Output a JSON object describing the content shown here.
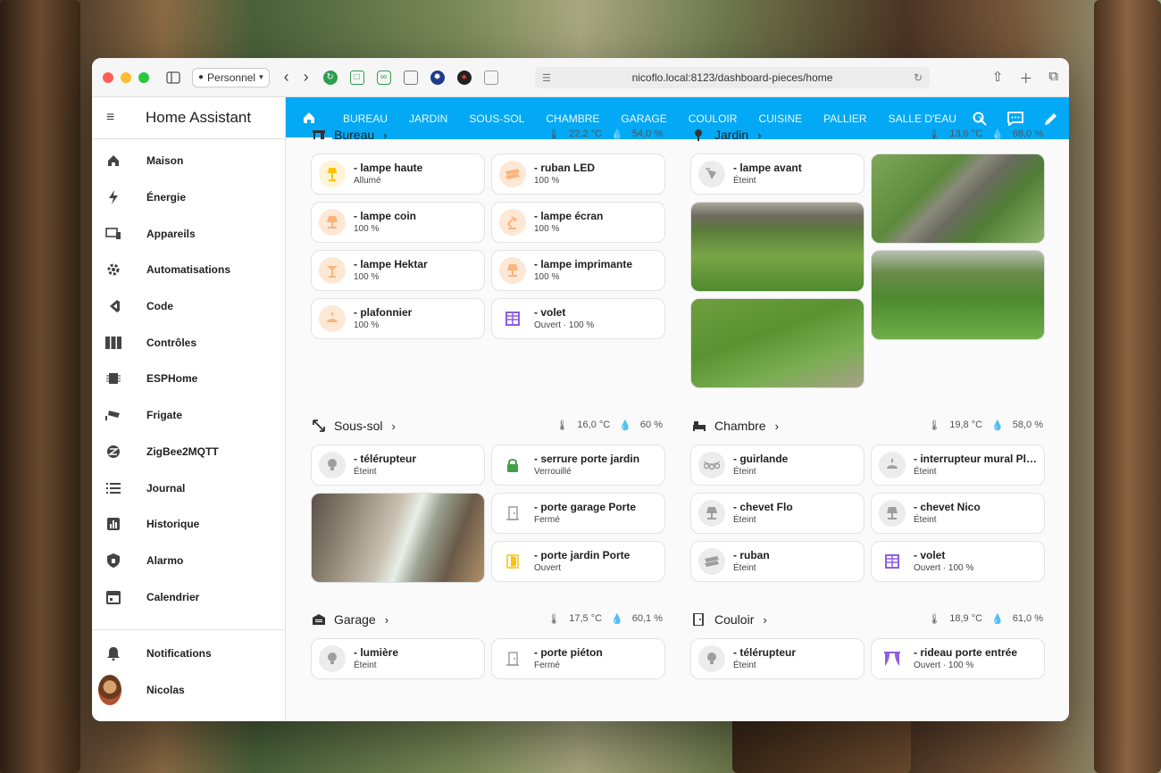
{
  "browser": {
    "profile": "Personnel",
    "url": "nicoflo.local:8123/dashboard-pieces/home"
  },
  "app": {
    "title": "Home Assistant"
  },
  "sidebar": {
    "items": [
      {
        "label": "Maison",
        "icon": "home-icon"
      },
      {
        "label": "Énergie",
        "icon": "lightning-icon"
      },
      {
        "label": "Appareils",
        "icon": "devices-icon"
      },
      {
        "label": "Automatisations",
        "icon": "robot-icon"
      },
      {
        "label": "Code",
        "icon": "code-icon"
      },
      {
        "label": "Contrôles",
        "icon": "controls-icon"
      },
      {
        "label": "ESPHome",
        "icon": "chip-icon"
      },
      {
        "label": "Frigate",
        "icon": "cctv-icon"
      },
      {
        "label": "ZigBee2MQTT",
        "icon": "zigbee-icon"
      },
      {
        "label": "Journal",
        "icon": "list-icon"
      },
      {
        "label": "Historique",
        "icon": "chart-icon"
      },
      {
        "label": "Alarmo",
        "icon": "shield-icon"
      },
      {
        "label": "Calendrier",
        "icon": "calendar-icon"
      }
    ],
    "notifications": "Notifications",
    "user": "Nicolas"
  },
  "tabs": [
    "BUREAU",
    "JARDIN",
    "SOUS-SOL",
    "CHAMBRE",
    "GARAGE",
    "COULOIR",
    "CUISINE",
    "PALLIER",
    "SALLE D'EAU"
  ],
  "sections": {
    "bureau": {
      "title": "Bureau",
      "temp": "22,2 °C",
      "hum": "54,0 %",
      "cards": [
        {
          "name": "- lampe haute",
          "state": "Allumé"
        },
        {
          "name": "- ruban LED",
          "state": "100 %"
        },
        {
          "name": "- lampe coin",
          "state": "100 %"
        },
        {
          "name": "- lampe écran",
          "state": "100 %"
        },
        {
          "name": "- lampe Hektar",
          "state": "100 %"
        },
        {
          "name": "- lampe imprimante",
          "state": "100 %"
        },
        {
          "name": "- plafonnier",
          "state": "100 %"
        },
        {
          "name": "- volet",
          "state": "Ouvert · 100 %"
        }
      ]
    },
    "jardin": {
      "title": "Jardin",
      "temp": "13,6 °C",
      "hum": "68,0 %",
      "cards": [
        {
          "name": "- lampe avant",
          "state": "Éteint"
        }
      ]
    },
    "soussol": {
      "title": "Sous-sol",
      "temp": "16,0 °C",
      "hum": "60 %",
      "cards": [
        {
          "name": "- télérupteur",
          "state": "Éteint"
        },
        {
          "name": "- serrure porte jardin",
          "state": "Verrouillé"
        },
        {
          "name": "- porte garage Porte",
          "state": "Fermé"
        },
        {
          "name": "- porte jardin Porte",
          "state": "Ouvert"
        }
      ]
    },
    "chambre": {
      "title": "Chambre",
      "temp": "19,8 °C",
      "hum": "58,0 %",
      "cards": [
        {
          "name": "- guirlande",
          "state": "Éteint"
        },
        {
          "name": "- interrupteur mural Plaf...",
          "state": "Éteint"
        },
        {
          "name": "- chevet Flo",
          "state": "Éteint"
        },
        {
          "name": "- chevet Nico",
          "state": "Éteint"
        },
        {
          "name": "- ruban",
          "state": "Éteint"
        },
        {
          "name": "- volet",
          "state": "Ouvert · 100 %"
        }
      ]
    },
    "garage": {
      "title": "Garage",
      "temp": "17,5 °C",
      "hum": "60,1 %",
      "cards": [
        {
          "name": "- lumière",
          "state": "Éteint"
        },
        {
          "name": "- porte piéton",
          "state": "Fermé"
        }
      ]
    },
    "couloir": {
      "title": "Couloir",
      "temp": "18,9 °C",
      "hum": "61,0 %",
      "cards": [
        {
          "name": "- télérupteur",
          "state": "Éteint"
        },
        {
          "name": "- rideau porte entrée",
          "state": "Ouvert · 100 %"
        }
      ]
    }
  },
  "colors": {
    "accent": "#03a9f4",
    "light_on": "#ffc107",
    "light_dim": "#ffb27a",
    "lock": "#43a047",
    "door_open": "#ffc107",
    "cover": "#8e5ee0",
    "off": "#9e9e9e"
  }
}
